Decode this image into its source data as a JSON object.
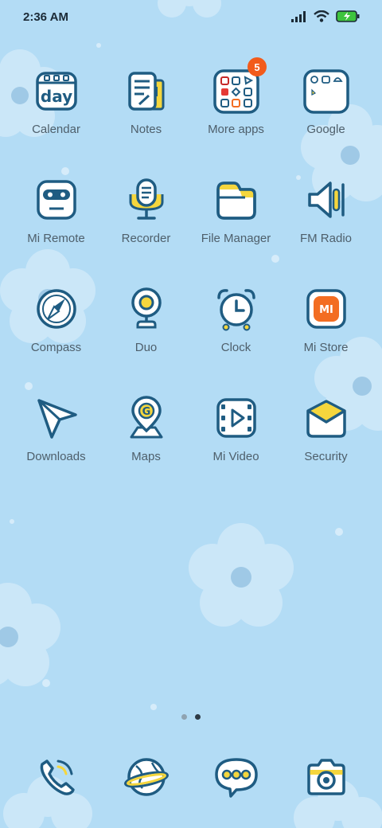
{
  "status_bar": {
    "time": "2:36 AM",
    "icons": [
      "signal-icon",
      "wifi-icon",
      "battery-charging-icon"
    ]
  },
  "home": {
    "apps": [
      {
        "label": "Calendar",
        "icon": "calendar-icon",
        "icon_text": "day"
      },
      {
        "label": "Notes",
        "icon": "notes-icon"
      },
      {
        "label": "More apps",
        "icon": "folder-icon",
        "badge": "5"
      },
      {
        "label": "Google",
        "icon": "folder-icon"
      },
      {
        "label": "Mi Remote",
        "icon": "remote-icon"
      },
      {
        "label": "Recorder",
        "icon": "microphone-icon"
      },
      {
        "label": "File Manager",
        "icon": "folder-icon"
      },
      {
        "label": "FM Radio",
        "icon": "speaker-icon"
      },
      {
        "label": "Compass",
        "icon": "compass-icon"
      },
      {
        "label": "Duo",
        "icon": "webcam-icon"
      },
      {
        "label": "Clock",
        "icon": "alarm-clock-icon"
      },
      {
        "label": "Mi Store",
        "icon": "mi-store-icon",
        "icon_text": "MI"
      },
      {
        "label": "Downloads",
        "icon": "paper-plane-icon"
      },
      {
        "label": "Maps",
        "icon": "map-pin-icon",
        "icon_text": "G"
      },
      {
        "label": "Mi Video",
        "icon": "video-player-icon"
      },
      {
        "label": "Security",
        "icon": "security-shield-icon"
      }
    ],
    "page_indicator": {
      "pages": 2,
      "current": 2
    }
  },
  "dock": {
    "apps": [
      {
        "icon": "phone-icon"
      },
      {
        "icon": "browser-globe-icon"
      },
      {
        "icon": "messages-icon"
      },
      {
        "icon": "camera-icon"
      }
    ]
  },
  "colors": {
    "background": "#b3dcf5",
    "icon_stroke": "#1f5c82",
    "icon_fill": "#ffffff",
    "accent_yellow": "#f5d63d",
    "badge": "#f25b1b",
    "mi_orange": "#f36d22",
    "label": "#4e5f6b"
  }
}
